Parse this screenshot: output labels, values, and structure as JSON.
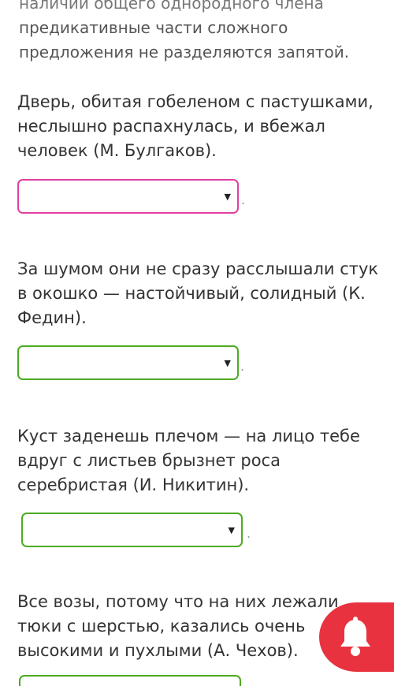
{
  "intro": {
    "line1": "наличии общего однородного члена",
    "line2": "предикативные части сложного",
    "line3": "предложения не разделяются запятой."
  },
  "items": [
    {
      "text": "Дверь, обитая гобеленом с пастушками, неслышно распахнулась, и вбежал человек (М. Булгаков).",
      "punct": "."
    },
    {
      "text": "За шумом они не сразу расслышали стук в окошко — настойчивый, солидный (К. Федин).",
      "punct": "."
    },
    {
      "text": "Куст заденешь плечом — на лицо тебе вдруг с листьев брызнет роса серебристая (И. Никитин).",
      "punct": "."
    },
    {
      "text": "Все возы, потому что на них лежали тюки с шерстью, казались очень высокими и пухлыми (А. Чехов).",
      "punct": ""
    }
  ],
  "select_arrow": "▼",
  "colors": {
    "pink_border": "#e23fa0",
    "green_border": "#4caa21",
    "bell_bg": "#e8323f"
  },
  "icons": {
    "notification": "bell-icon",
    "dropdown": "caret-down-icon"
  }
}
